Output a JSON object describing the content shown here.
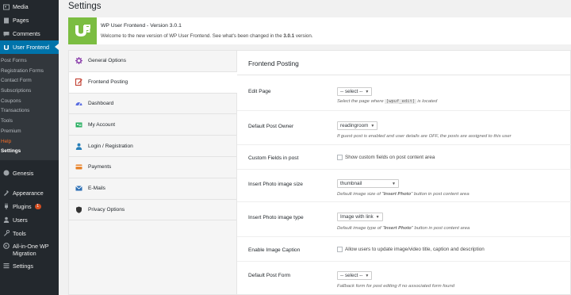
{
  "admin_menu": {
    "top_items": [
      {
        "label": "Media",
        "icon": "media-icon"
      },
      {
        "label": "Pages",
        "icon": "pages-icon"
      },
      {
        "label": "Comments",
        "icon": "comments-icon"
      }
    ],
    "current": {
      "label": "User Frontend",
      "icon": "user-frontend-icon"
    },
    "submenu": [
      "Post Forms",
      "Registration Forms",
      "Contact Form",
      "Subscriptions",
      "Coupons",
      "Transactions",
      "Tools",
      "Premium",
      "Help",
      "Settings"
    ],
    "bottom_items": [
      {
        "label": "Genesis",
        "icon": "genesis-icon"
      },
      {
        "label": "Appearance",
        "icon": "appearance-icon"
      },
      {
        "label": "Plugins",
        "icon": "plugins-icon",
        "badge": "1"
      },
      {
        "label": "Users",
        "icon": "users-icon"
      },
      {
        "label": "Tools",
        "icon": "tools-icon"
      },
      {
        "label": "All-in-One WP Migration",
        "icon": "migration-icon"
      },
      {
        "label": "Settings",
        "icon": "settings-icon"
      }
    ]
  },
  "page": {
    "title": "Settings"
  },
  "notice": {
    "title": "WP User Frontend - Version 3.0.1",
    "text_before": "Welcome to the new version of WP User Frontend. See what's been changed in the ",
    "version": "3.0.1",
    "text_after": " version."
  },
  "tabs": [
    {
      "label": "General Options",
      "icon": "gear-icon",
      "color": "#8e44ad"
    },
    {
      "label": "Frontend Posting",
      "icon": "post-icon",
      "color": "#c0392b"
    },
    {
      "label": "Dashboard",
      "icon": "dashboard-icon",
      "color": "#5b6ee1"
    },
    {
      "label": "My Account",
      "icon": "account-icon",
      "color": "#27ae60"
    },
    {
      "label": "Login / Registration",
      "icon": "login-icon",
      "color": "#2980b9"
    },
    {
      "label": "Payments",
      "icon": "payments-icon",
      "color": "#e67e22"
    },
    {
      "label": "E-Mails",
      "icon": "email-icon",
      "color": "#2c6fb5"
    },
    {
      "label": "Privacy Options",
      "icon": "shield-icon",
      "color": "#333333"
    }
  ],
  "section": {
    "title": "Frontend Posting",
    "fields": {
      "edit_page": {
        "label": "Edit Page",
        "value": "-- select --",
        "desc_before": "Select the page where ",
        "desc_code": "[wpuf_edit]",
        "desc_after": " is located"
      },
      "default_owner": {
        "label": "Default Post Owner",
        "value": "readingroom",
        "desc": "If guest post is enabled and user details are OFF, the posts are assigned to this user"
      },
      "custom_fields": {
        "label": "Custom Fields in post",
        "checkbox_label": "Show custom fields on post content area"
      },
      "photo_size": {
        "label": "Insert Photo image size",
        "value": "thumbnail",
        "desc_before": "Default image size of \"",
        "desc_bold": "Insert Photo",
        "desc_after": "\" button in post content area"
      },
      "photo_type": {
        "label": "Insert Photo image type",
        "value": "Image with link",
        "desc_before": "Default image type of \"",
        "desc_bold": "Insert Photo",
        "desc_after": "\" button in post content area"
      },
      "image_caption": {
        "label": "Enable Image Caption",
        "checkbox_label": "Allow users to update image/video title, caption and description"
      },
      "default_form": {
        "label": "Default Post Form",
        "value": "-- select --",
        "desc": "Fallback form for post editing if no associated form found"
      }
    }
  },
  "colors": {
    "sidebar": "#23282d",
    "submenu": "#32373c",
    "current": "#0073aa",
    "logo": "#7bbd41",
    "help": "#f56e28"
  }
}
